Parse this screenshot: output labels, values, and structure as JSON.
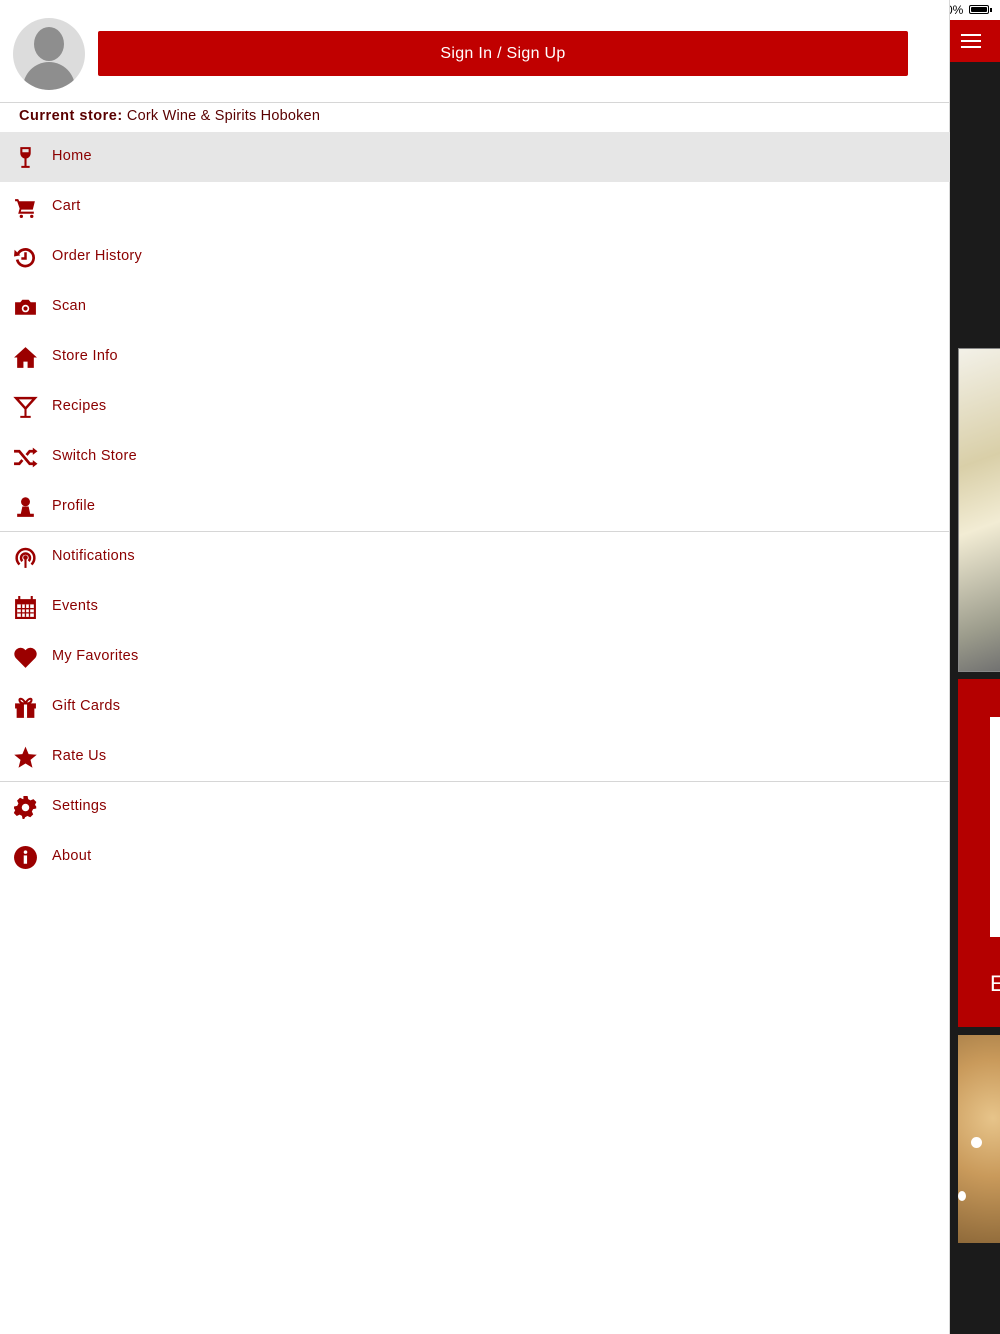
{
  "status": {
    "battery_text": "0%"
  },
  "header": {
    "sign_in_label": "Sign In / Sign Up"
  },
  "store": {
    "label": "Current store:",
    "name": "Cork Wine & Spirits Hoboken"
  },
  "menu": {
    "home": "Home",
    "cart": "Cart",
    "order_history": "Order History",
    "scan": "Scan",
    "store_info": "Store Info",
    "recipes": "Recipes",
    "switch_store": "Switch Store",
    "profile": "Profile",
    "notifications": "Notifications",
    "events": "Events",
    "my_favorites": "My Favorites",
    "gift_cards": "Gift Cards",
    "rate_us": "Rate Us",
    "settings": "Settings",
    "about": "About"
  },
  "background": {
    "card_letter": "E"
  },
  "icons": {
    "home": "wine-glass-icon",
    "cart": "cart-icon",
    "order_history": "history-icon",
    "scan": "camera-icon",
    "store_info": "house-icon",
    "recipes": "cocktail-icon",
    "switch_store": "shuffle-icon",
    "profile": "person-icon",
    "notifications": "broadcast-icon",
    "events": "calendar-icon",
    "my_favorites": "heart-icon",
    "gift_cards": "gift-icon",
    "rate_us": "star-icon",
    "settings": "gear-icon",
    "about": "info-icon"
  },
  "colors": {
    "accent": "#c00000",
    "menu_text": "#8b0000",
    "active_row": "#e6e6e6"
  }
}
